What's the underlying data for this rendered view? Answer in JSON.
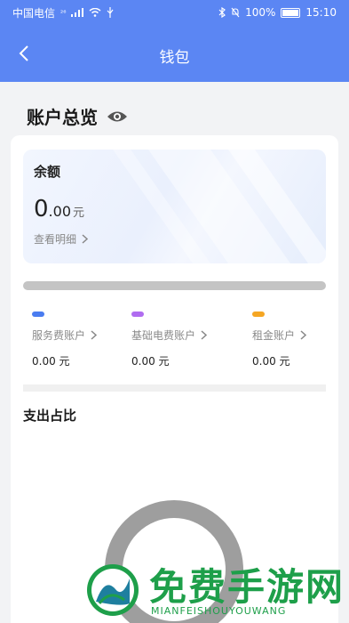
{
  "status": {
    "carrier": "中国电信",
    "network": "²⁶",
    "battery": "100%",
    "time": "15:10"
  },
  "header": {
    "title": "钱包"
  },
  "overview": {
    "title": "账户总览"
  },
  "balance": {
    "label": "余额",
    "integer": "0",
    "decimal": ".00",
    "unit": "元",
    "detail_link": "查看明细"
  },
  "accounts": [
    {
      "name": "服务费账户",
      "amount": "0.00 元",
      "color": "#4a7cf0"
    },
    {
      "name": "基础电费账户",
      "amount": "0.00 元",
      "color": "#b06cf0"
    },
    {
      "name": "租金账户",
      "amount": "0.00 元",
      "color": "#f5a623"
    }
  ],
  "expense": {
    "title": "支出占比"
  },
  "watermark": {
    "title": "免费手游网",
    "subtitle": "MIANFEISHOUYOUWANG"
  },
  "colors": {
    "brand": "#5b86f3",
    "donut": "#9e9e9e",
    "watermark": "#1e9f4a"
  }
}
